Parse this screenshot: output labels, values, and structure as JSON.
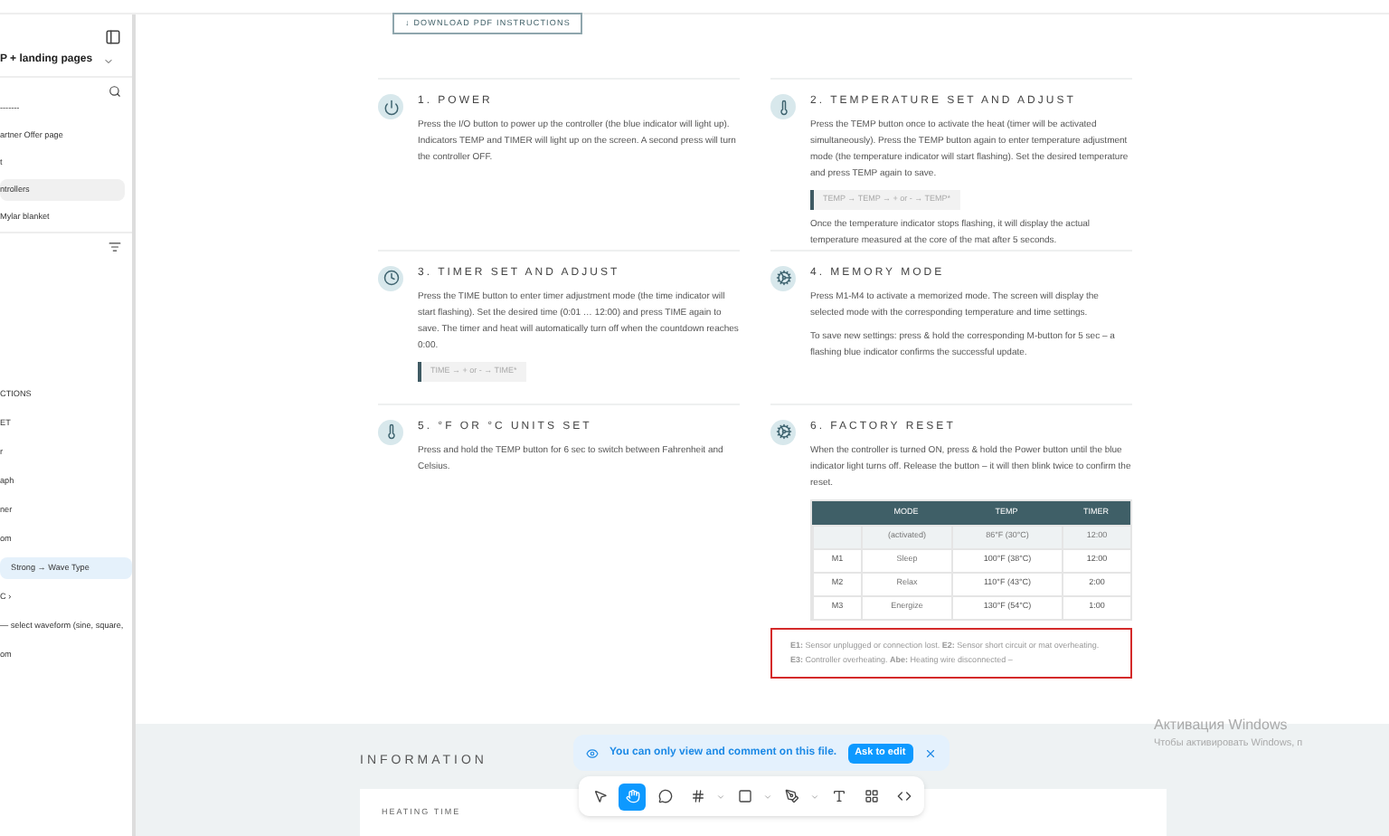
{
  "sidebar": {
    "title": "P + landing pages",
    "pages": [
      {
        "label": "-------",
        "selected": false
      },
      {
        "label": "artner Offer page",
        "selected": false
      },
      {
        "label": "t",
        "selected": false
      },
      {
        "label": "ntrollers",
        "selected": true
      },
      {
        "label": "Mylar blanket",
        "selected": false
      }
    ],
    "layers": [
      {
        "label": "CTIONS",
        "selected": false
      },
      {
        "label": "ET",
        "selected": false
      },
      {
        "label": "r",
        "selected": false
      },
      {
        "label": "aph",
        "selected": false
      },
      {
        "label": "ner",
        "selected": false
      },
      {
        "label": "om",
        "selected": false
      },
      {
        "label": "Strong → Wave Type",
        "selected": true
      },
      {
        "label": "C ›",
        "selected": false
      },
      {
        "label": "— select waveform (sine, square,",
        "selected": false
      },
      {
        "label": "om",
        "selected": false
      }
    ]
  },
  "download_button": "↓ DOWNLOAD PDF INSTRUCTIONS",
  "sections": [
    {
      "kind": "power",
      "title": "1.  POWER",
      "paragraphs": [
        "Press the I/O button to power up the controller (the blue indicator will light up). Indicators TEMP and TIMER will light up on the screen. A second press will turn the controller OFF."
      ]
    },
    {
      "kind": "temp",
      "title": "2.  TEMPERATURE SET AND ADJUST",
      "paragraphs": [
        "Press the TEMP button once to activate the heat (timer will be activated simultaneously). Press the TEMP button again to enter temperature adjustment mode (the temperature indicator will start flashing). Set the desired temperature and press TEMP again to save."
      ],
      "code": "TEMP → TEMP → + or - → TEMP*",
      "after": [
        "Once the temperature indicator stops flashing, it will display the actual temperature measured at the core of the mat after 5 seconds."
      ]
    },
    {
      "kind": "clock",
      "title": "3.  TIMER SET AND ADJUST",
      "paragraphs": [
        "Press the TIME button to enter timer adjustment mode (the time indicator will start flashing). Set the desired time (0:01 … 12:00) and press TIME again to save. The timer and heat will automatically turn off when the countdown reaches 0:00."
      ],
      "code": "TIME → + or - → TIME*"
    },
    {
      "kind": "memory",
      "title": "4.  MEMORY MODE",
      "paragraphs": [
        "Press M1-M4 to activate a memorized mode. The screen will display the selected mode with the corresponding temperature and time settings.",
        "To save new settings: press & hold the corresponding M-button for 5 sec – a flashing blue indicator confirms the successful update."
      ]
    },
    {
      "kind": "temp",
      "title": "5.  °F OR °C UNITS SET",
      "paragraphs": [
        "Press and hold the TEMP button for 6 sec to switch between Fahrenheit and Celsius."
      ]
    },
    {
      "kind": "memory",
      "title": "6.  FACTORY RESET",
      "paragraphs": [
        "When the controller is turned ON, press & hold the Power button until the blue indicator light turns off. Release the button – it will then blink twice to confirm the reset."
      ],
      "table": {
        "columns": [
          "",
          "MODE",
          "TEMP",
          "TIMER"
        ],
        "rows": [
          [
            "",
            "(activated)",
            "86°F (30°C)",
            "12:00"
          ],
          [
            "M1",
            "Sleep",
            "100°F (38°C)",
            "12:00"
          ],
          [
            "M2",
            "Relax",
            "110°F (43°C)",
            "2:00"
          ],
          [
            "M3",
            "Energize",
            "130°F (54°C)",
            "1:00"
          ]
        ]
      },
      "errors": "**E1:** Sensor unplugged or connection lost.  **E2:** Sensor short circuit or mat overheating.  **E3:** Controller overheating.  **Abe:** Heating wire disconnected –"
    }
  ],
  "information": {
    "title": "INFORMATION",
    "card_title": "HEATING TIME"
  },
  "toast": {
    "message": "You can only view and comment on this file.",
    "button": "Ask to edit"
  },
  "toolbar": [
    {
      "kind": "pointer",
      "selected": false
    },
    {
      "kind": "hand",
      "selected": true
    },
    {
      "kind": "comment",
      "selected": false
    },
    {
      "kind": "frame",
      "selected": false
    },
    {
      "kind": "rect",
      "selected": false
    },
    {
      "kind": "pen",
      "selected": false
    },
    {
      "kind": "text",
      "selected": false
    },
    {
      "kind": "components",
      "selected": false
    },
    {
      "kind": "code",
      "selected": false
    }
  ],
  "windows_activation": {
    "title": "Активация Windows",
    "subtitle": "Чтобы активировать Windows, п"
  }
}
